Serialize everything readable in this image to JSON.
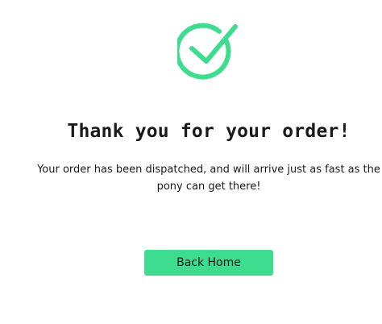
{
  "icon": {
    "name": "checkmark-circle-icon",
    "color": "#3ddc8f"
  },
  "confirmation": {
    "title": "Thank you for your order!",
    "message": "Your order has been dispatched, and will arrive just as fast as the pony can get there!"
  },
  "actions": {
    "back_home_label": "Back Home",
    "button_color": "#3ddc8f"
  }
}
